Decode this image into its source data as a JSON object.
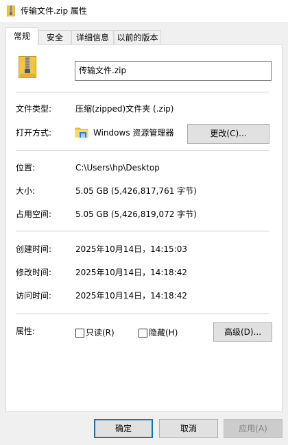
{
  "window": {
    "title": "传输文件.zip 属性"
  },
  "tabs": [
    {
      "label": "常规",
      "active": true
    },
    {
      "label": "安全"
    },
    {
      "label": "详细信息"
    },
    {
      "label": "以前的版本"
    }
  ],
  "general": {
    "file_name": "传输文件.zip",
    "type_label": "文件类型:",
    "type_value": "压缩(zipped)文件夹 (.zip)",
    "open_with_label": "打开方式:",
    "open_with_app": "Windows 资源管理器",
    "change_button": "更改(C)...",
    "location_label": "位置:",
    "location_value": "C:\\Users\\hp\\Desktop",
    "size_label": "大小:",
    "size_value": "5.05 GB (5,426,817,761 字节)",
    "size_on_disk_label": "占用空间:",
    "size_on_disk_value": "5.05 GB (5,426,819,072 字节)",
    "created_label": "创建时间:",
    "created_value": "2025年10月14日，14:15:03",
    "modified_label": "修改时间:",
    "modified_value": "2025年10月14日，14:18:42",
    "accessed_label": "访问时间:",
    "accessed_value": "2025年10月14日，14:18:42",
    "attributes_label": "属性:",
    "readonly_label": "只读(R)",
    "readonly_checked": false,
    "hidden_label": "隐藏(H)",
    "hidden_checked": false,
    "advanced_button": "高级(D)..."
  },
  "footer": {
    "ok": "确定",
    "cancel": "取消",
    "apply": "应用(A)"
  },
  "colors": {
    "accent": "#0078d7",
    "zip_yellow": "#f2c445",
    "zip_dark": "#d9a520"
  }
}
